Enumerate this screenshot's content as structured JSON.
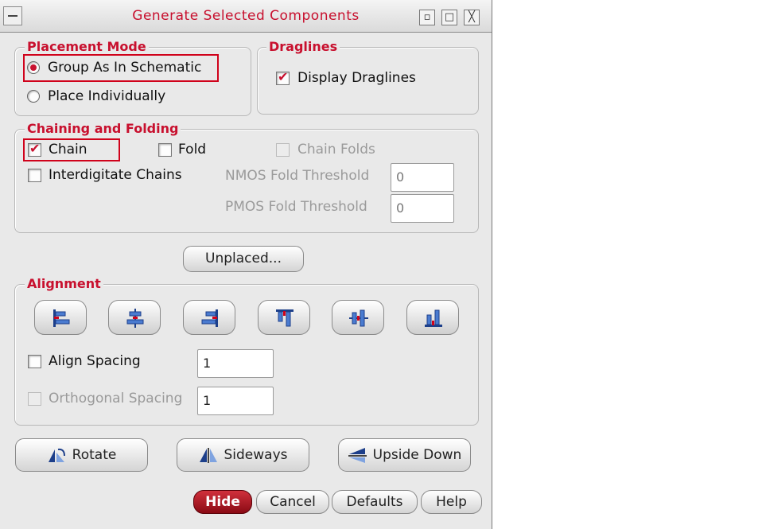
{
  "window": {
    "title": "Generate Selected Components",
    "menu_icon": "window-menu-icon",
    "ctrl_min": "▫",
    "ctrl_max": "□",
    "ctrl_close": "╳"
  },
  "placement": {
    "legend": "Placement Mode",
    "group_as": "Group As In Schematic",
    "group_as_selected": true,
    "individually": "Place Individually"
  },
  "draglines": {
    "legend": "Draglines",
    "display": "Display Draglines",
    "display_checked": true
  },
  "chaining": {
    "legend": "Chaining and Folding",
    "chain": "Chain",
    "chain_checked": true,
    "fold": "Fold",
    "fold_checked": false,
    "chain_folds": "Chain Folds",
    "interdigitate": "Interdigitate Chains",
    "nmos_label": "NMOS Fold Threshold",
    "nmos_value": "0",
    "pmos_label": "PMOS Fold Threshold",
    "pmos_value": "0"
  },
  "unplaced": {
    "label": "Unplaced..."
  },
  "alignment": {
    "legend": "Alignment",
    "icons": [
      "align-left-icon",
      "align-center-horizontal-icon",
      "align-right-icon",
      "align-top-icon",
      "align-center-vertical-icon",
      "align-bottom-icon"
    ],
    "align_spacing": "Align Spacing",
    "align_spacing_value": "1",
    "orthogonal_spacing": "Orthogonal Spacing",
    "orthogonal_spacing_value": "1"
  },
  "transforms": {
    "rotate": "Rotate",
    "sideways": "Sideways",
    "upside_down": "Upside Down"
  },
  "footer": {
    "hide": "Hide",
    "cancel": "Cancel",
    "defaults": "Defaults",
    "help": "Help"
  },
  "colors": {
    "accent": "#c8102e",
    "dialog_bg": "#e9e9e9",
    "hide_button": "#a8101e"
  }
}
